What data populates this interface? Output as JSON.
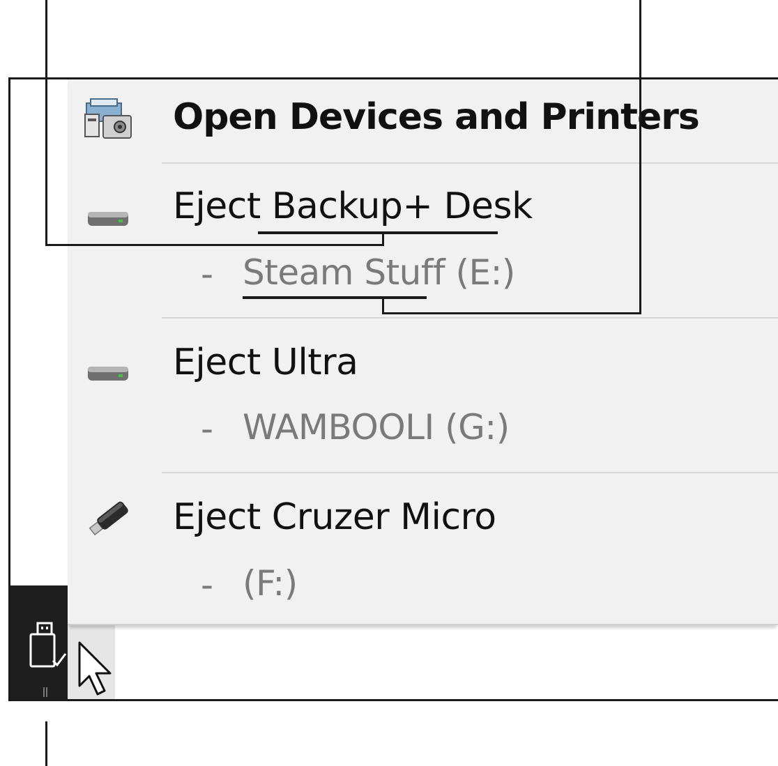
{
  "menu": {
    "open_devices": {
      "label": "Open Devices and Printers",
      "icon": "devices-printers-icon"
    },
    "devices": [
      {
        "label": "Eject Backup+  Desk",
        "volume": "Steam Stuff (E:)",
        "icon": "external-drive-icon"
      },
      {
        "label": "Eject Ultra",
        "volume": "WAMBOOLI (G:)",
        "icon": "external-drive-icon"
      },
      {
        "label": "Eject Cruzer Micro",
        "volume": " (F:)",
        "icon": "usb-stick-icon"
      }
    ],
    "volume_prefix": "-"
  },
  "taskbar": {
    "tray_icon": "safely-remove-hardware-icon"
  },
  "colors": {
    "menu_background": "#f1f1f1",
    "taskbar": "#1e1e1e",
    "label_text": "#111111",
    "volume_text": "#7a7a7a"
  }
}
